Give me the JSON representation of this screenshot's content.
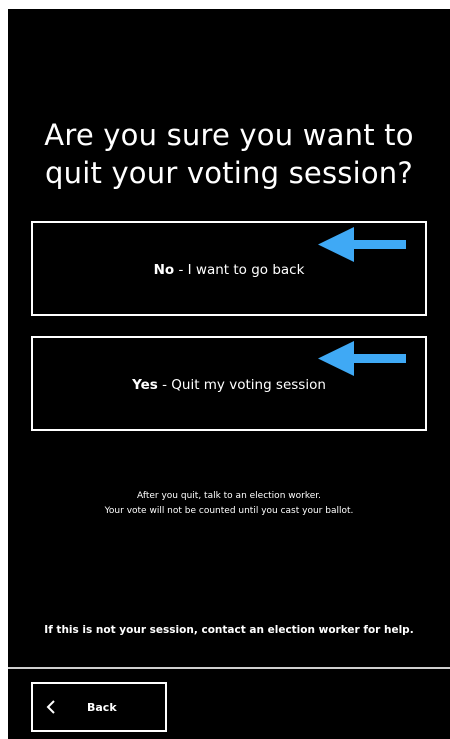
{
  "dialog": {
    "title_line1": "Are you sure you want to",
    "title_line2": "quit your voting session?"
  },
  "options": {
    "no": {
      "strong": "No",
      "rest": " - I want to go back"
    },
    "yes": {
      "strong": "Yes",
      "rest": " - Quit my voting session"
    }
  },
  "info": {
    "line1": "After you quit, talk to an election worker.",
    "line2": "Your vote will not be counted until you cast your ballot."
  },
  "help_text": "If this is not your session, contact an election worker for help.",
  "footer": {
    "back_label": "Back",
    "back_icon": "chevron-left-icon"
  },
  "colors": {
    "background": "#000000",
    "text": "#ffffff",
    "arrow": "#3fa9f5"
  }
}
